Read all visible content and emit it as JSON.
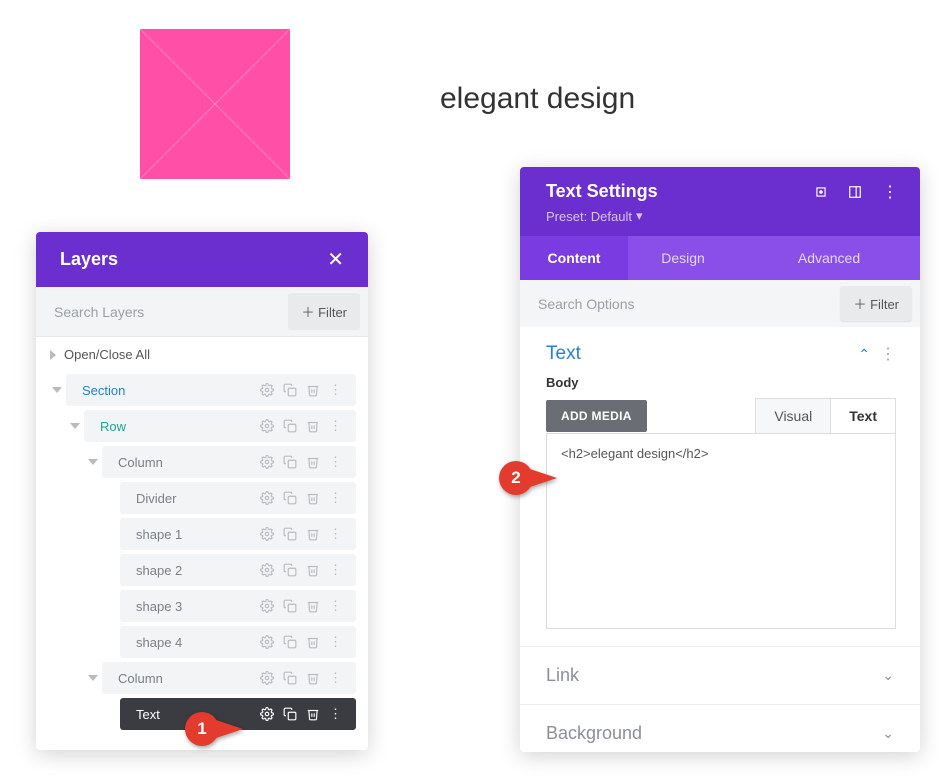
{
  "canvas": {
    "heading": "elegant design"
  },
  "layers": {
    "title": "Layers",
    "search_ph": "Search Layers",
    "filter": "Filter",
    "open_close": "Open/Close All",
    "items": {
      "section": "Section",
      "row": "Row",
      "col1": "Column",
      "divider": "Divider",
      "shape1": "shape 1",
      "shape2": "shape 2",
      "shape3": "shape 3",
      "shape4": "shape 4",
      "col2": "Column",
      "text": "Text"
    }
  },
  "settings": {
    "title": "Text Settings",
    "preset": "Preset: Default",
    "tabs": {
      "content": "Content",
      "design": "Design",
      "advanced": "Advanced"
    },
    "search_ph": "Search Options",
    "filter": "Filter",
    "text_section": "Text",
    "body_label": "Body",
    "add_media": "ADD MEDIA",
    "visual": "Visual",
    "text_tab": "Text",
    "editor_value": "<h2>elegant design</h2>",
    "link": "Link",
    "background": "Background"
  },
  "callouts": {
    "one": "1",
    "two": "2"
  }
}
